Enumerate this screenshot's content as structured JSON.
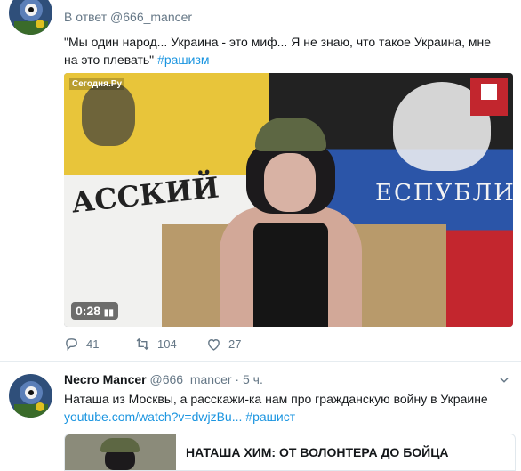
{
  "tweet1": {
    "reply_prefix": "В ответ",
    "reply_handle": "@666_mancer",
    "text": "\"Мы один народ... Украина - это миф... Я не знаю, что такое Украина, мне на это плевать\"",
    "hashtag": "#рашизм",
    "video": {
      "duration": "0:28",
      "watermark_left": "Сегодня.Ру",
      "flag_left_text": "АССКИЙ",
      "flag_right_text": "ЕСПУБЛИ"
    },
    "actions": {
      "replies": "41",
      "retweets": "104",
      "likes": "27"
    }
  },
  "tweet2": {
    "name": "Necro Mancer",
    "handle": "@666_mancer",
    "separator": "·",
    "time": "5 ч.",
    "text": "Наташа из Москвы, а расскажи-ка нам про гражданскую войну в Украине",
    "link": "youtube.com/watch?v=dwjzBu...",
    "hashtag": "#рашист",
    "card_title": "НАТАША ХИМ: ОТ ВОЛОНТЕРА ДО БОЙЦА"
  },
  "icons": {
    "reply": "reply-icon",
    "retweet": "retweet-icon",
    "like": "heart-icon",
    "caret": "chevron-down-icon"
  },
  "colors": {
    "link": "#1b95e0",
    "secondary": "#657786"
  }
}
